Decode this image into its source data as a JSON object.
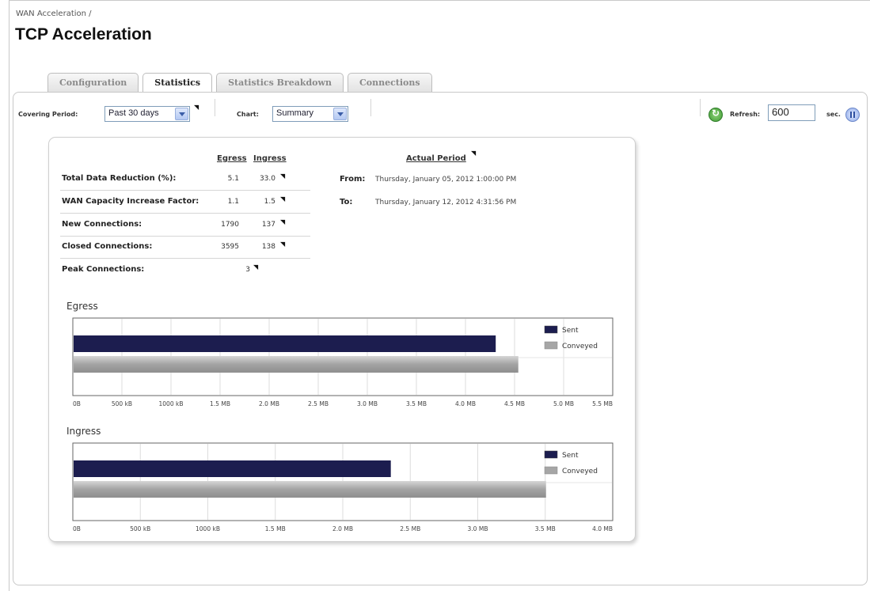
{
  "breadcrumb": "WAN Acceleration /",
  "title": "TCP Acceleration",
  "tabs": [
    {
      "label": "Configuration"
    },
    {
      "label": "Statistics"
    },
    {
      "label": "Statistics Breakdown"
    },
    {
      "label": "Connections"
    }
  ],
  "active_tab": "Statistics",
  "toolbar": {
    "covering_label": "Covering Period:",
    "covering_value": "Past 30 days",
    "chart_label": "Chart:",
    "chart_value": "Summary",
    "refresh_label": "Refresh:",
    "refresh_value": "600",
    "refresh_unit": "sec."
  },
  "stats": {
    "egress_header": "Egress",
    "ingress_header": "Ingress",
    "rows": [
      {
        "label": "Total Data Reduction (%):",
        "egress": "5.1",
        "ingress": "33.0"
      },
      {
        "label": "WAN Capacity Increase Factor:",
        "egress": "1.1",
        "ingress": "1.5"
      },
      {
        "label": "New Connections:",
        "egress": "1790",
        "ingress": "137"
      },
      {
        "label": "Closed Connections:",
        "egress": "3595",
        "ingress": "138"
      },
      {
        "label": "Peak Connections:",
        "egress": "3",
        "ingress": ""
      }
    ]
  },
  "period": {
    "header": "Actual Period",
    "from_label": "From:",
    "from_value": "Thursday, January 05, 2012 1:00:00 PM",
    "to_label": "To:",
    "to_value": "Thursday, January 12, 2012 4:31:56 PM"
  },
  "colors": {
    "sent": "#1c1d4f",
    "conveyed": "#a6a6a6"
  },
  "chart_data": [
    {
      "type": "bar",
      "title": "Egress",
      "orientation": "horizontal",
      "xticks": [
        "0B",
        "500 kB",
        "1000 kB",
        "1.5 MB",
        "2.0 MB",
        "2.5 MB",
        "3.0 MB",
        "3.5 MB",
        "4.0 MB",
        "4.5 MB",
        "5.0 MB",
        "5.5 MB"
      ],
      "xlim_mb": [
        0,
        5.5
      ],
      "series": [
        {
          "name": "Sent",
          "value_mb": 4.3
        },
        {
          "name": "Conveyed",
          "value_mb": 4.53
        }
      ],
      "legend": "top-right"
    },
    {
      "type": "bar",
      "title": "Ingress",
      "orientation": "horizontal",
      "xticks": [
        "0B",
        "500 kB",
        "1000 kB",
        "1.5 MB",
        "2.0 MB",
        "2.5 MB",
        "3.0 MB",
        "3.5 MB",
        "4.0 MB"
      ],
      "xlim_mb": [
        0,
        4.0
      ],
      "series": [
        {
          "name": "Sent",
          "value_mb": 2.35
        },
        {
          "name": "Conveyed",
          "value_mb": 3.5
        }
      ],
      "legend": "top-right"
    }
  ]
}
